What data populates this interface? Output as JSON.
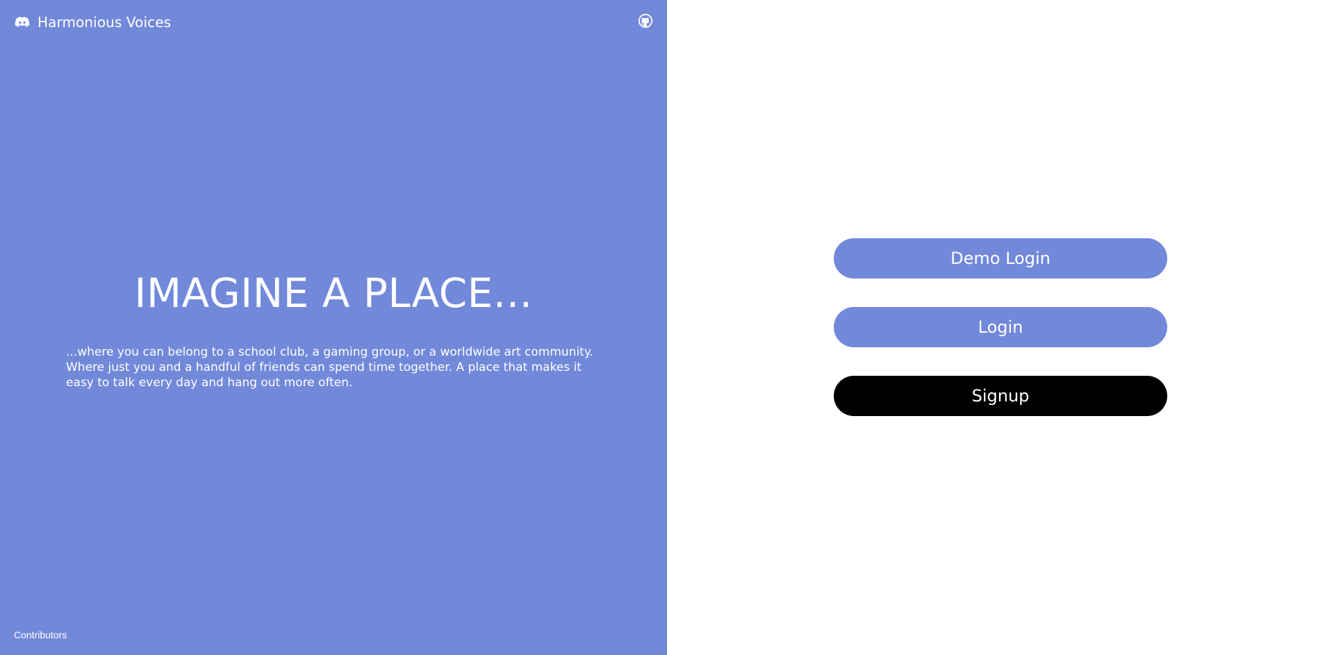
{
  "brand": {
    "name": "Harmonious Voices",
    "logo_icon": "discord-logo-icon"
  },
  "header": {
    "github_icon": "github-icon"
  },
  "hero": {
    "title": "IMAGINE A PLACE...",
    "text": "...where you can belong to a school club, a gaming group, or a worldwide art community. Where just you and a handful of friends can spend time together. A place that makes it easy to talk every day and hang out more often."
  },
  "footer": {
    "contributors_label": "Contributors"
  },
  "auth": {
    "demo_login_label": "Demo Login",
    "login_label": "Login",
    "signup_label": "Signup"
  },
  "colors": {
    "brand_blurple": "#7289da",
    "signup_button": "#000000",
    "text_on_brand": "#ffffff",
    "background": "#ffffff"
  }
}
